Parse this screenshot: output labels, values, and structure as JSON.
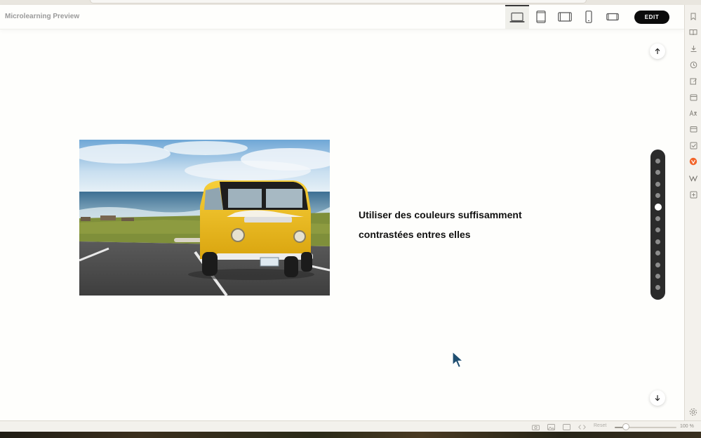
{
  "app": {
    "title": "Microlearning Preview",
    "edit_label": "EDIT"
  },
  "devices": [
    "laptop-icon",
    "tablet-portrait-icon",
    "tablet-landscape-icon",
    "phone-portrait-icon",
    "phone-landscape-icon"
  ],
  "active_device": "laptop-icon",
  "slide": {
    "text_line1": "Utiliser des couleurs suffisamment",
    "text_line2": "contrastées entres elles",
    "image": "yellow-van-photo"
  },
  "pager": {
    "total": 12,
    "active_index": 4
  },
  "sidebar_icons": [
    "bookmark-icon",
    "reader-icon",
    "download-icon",
    "history-icon",
    "edit-note-icon",
    "calendar-icon",
    "translate-icon",
    "wallet-icon",
    "checklist-icon",
    "brave-rewards-icon",
    "wikipedia-icon",
    "add-panel-icon",
    "settings-icon"
  ],
  "status": {
    "reset_label": "Reset",
    "zoom_label": "100 %",
    "zoom_value": 0.18
  },
  "colors": {
    "accent": "#0b0b0b",
    "pager_bg": "#2b2b2b",
    "van": "#f3c21c"
  }
}
